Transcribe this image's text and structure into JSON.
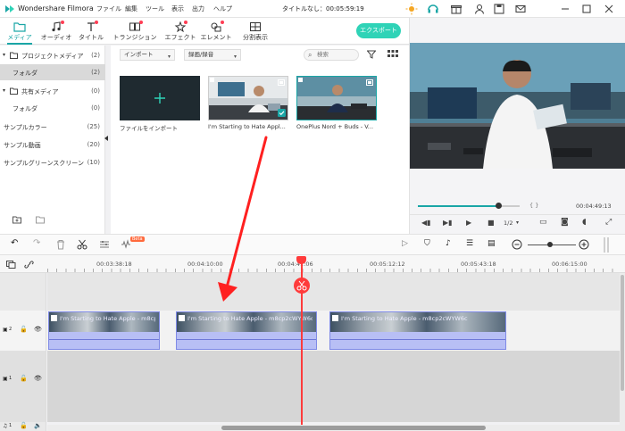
{
  "app": {
    "name": "Wondershare Filmora",
    "menu": [
      "ファイル",
      "編集",
      "ツール",
      "表示",
      "出力",
      "ヘルプ"
    ],
    "doc_title": "タイトルなし：00:05:59:19"
  },
  "toolbar": {
    "tabs": [
      {
        "label": "メディア",
        "icon": "folder-icon"
      },
      {
        "label": "オーディオ",
        "icon": "music-note-icon"
      },
      {
        "label": "タイトル",
        "icon": "text-icon"
      },
      {
        "label": "トランジション",
        "icon": "transition-icon"
      },
      {
        "label": "エフェクト",
        "icon": "effects-icon"
      },
      {
        "label": "エレメント",
        "icon": "elements-icon"
      },
      {
        "label": "分割表示",
        "icon": "split-screen-icon"
      }
    ],
    "export_label": "エクスポート"
  },
  "library": {
    "items": [
      {
        "label": "プロジェクトメディア",
        "count": "(2)"
      },
      {
        "label": "フォルダ",
        "count": "(2)"
      },
      {
        "label": "共有メディア",
        "count": "(0)"
      },
      {
        "label": "フォルダ",
        "count": "(0)"
      },
      {
        "label": "サンプルカラー",
        "count": "(25)"
      },
      {
        "label": "サンプル動画",
        "count": "(20)"
      },
      {
        "label": "サンプルグリーンスクリーン",
        "count": "(10)"
      }
    ]
  },
  "media": {
    "import_dropdown": "インポート",
    "record_dropdown": "録画/録音",
    "search_placeholder": "検索",
    "import_tile_label": "ファイルをインポート",
    "clips": [
      {
        "caption": "I'm Starting to Hate Appl..."
      },
      {
        "caption": "OnePlus Nord + Buds - V..."
      }
    ]
  },
  "preview": {
    "braces": "{   }",
    "time": "00:04:49:13",
    "quality": "1/2"
  },
  "timeline": {
    "timecodes": [
      "00:03:38:18",
      "00:04:10:00",
      "00:04:41:06",
      "00:05:12:12",
      "00:05:43:18",
      "00:06:15:00"
    ],
    "track2_label": "2",
    "track1_label": "1",
    "track_audio_label": "1",
    "clips": [
      {
        "name": "I'm Starting to Hate Apple - m8cp2cWYW6c"
      },
      {
        "name": "I'm Starting to Hate Apple - m8cp2cWYW6c"
      },
      {
        "name": "I'm Starting to Hate Apple - m8cp2cWYW6c"
      }
    ],
    "beta_badge": "Beta"
  },
  "colors": {
    "accent": "#1aa6a6",
    "export": "#2fd3b7",
    "playhead": "#ff3b3b",
    "clip": "#b8bff5",
    "annotation_arrow": "#ff2020"
  }
}
